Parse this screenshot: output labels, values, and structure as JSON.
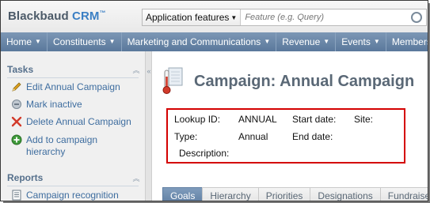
{
  "app": {
    "brand_name": "Blackbaud",
    "brand_product": "CRM",
    "brand_tm": "™"
  },
  "search": {
    "category_label": "Application features",
    "placeholder": "Feature (e.g. Query)"
  },
  "nav": {
    "items": [
      {
        "label": "Home"
      },
      {
        "label": "Constituents"
      },
      {
        "label": "Marketing and Communications"
      },
      {
        "label": "Revenue"
      },
      {
        "label": "Events"
      },
      {
        "label": "Membership"
      }
    ]
  },
  "sidebar": {
    "tasks_title": "Tasks",
    "tasks": [
      {
        "label": "Edit Annual Campaign",
        "icon": "pencil-icon"
      },
      {
        "label": "Mark inactive",
        "icon": "mark-inactive-icon"
      },
      {
        "label": "Delete Annual Campaign",
        "icon": "delete-x-icon"
      },
      {
        "label": "Add to campaign hierarchy",
        "icon": "add-circle-icon"
      }
    ],
    "reports_title": "Reports",
    "reports": [
      {
        "label": "Campaign recognition",
        "icon": "report-icon"
      }
    ]
  },
  "page": {
    "title": "Campaign: Annual Campaign",
    "icon": "thermometer-icon"
  },
  "summary": {
    "lookup_id_label": "Lookup ID:",
    "lookup_id_value": "ANNUAL",
    "start_date_label": "Start date:",
    "site_label": "Site:",
    "type_label": "Type:",
    "type_value": "Annual",
    "end_date_label": "End date:",
    "description_label": "Description:"
  },
  "tabs": [
    {
      "label": "Goals",
      "active": true
    },
    {
      "label": "Hierarchy",
      "active": false
    },
    {
      "label": "Priorities",
      "active": false
    },
    {
      "label": "Designations",
      "active": false
    },
    {
      "label": "Fundraisers",
      "active": false
    }
  ],
  "colors": {
    "nav_bar": "#6b88aa",
    "link": "#3e6d9f",
    "highlight_border": "#d40000",
    "section_header": "#56708c"
  }
}
